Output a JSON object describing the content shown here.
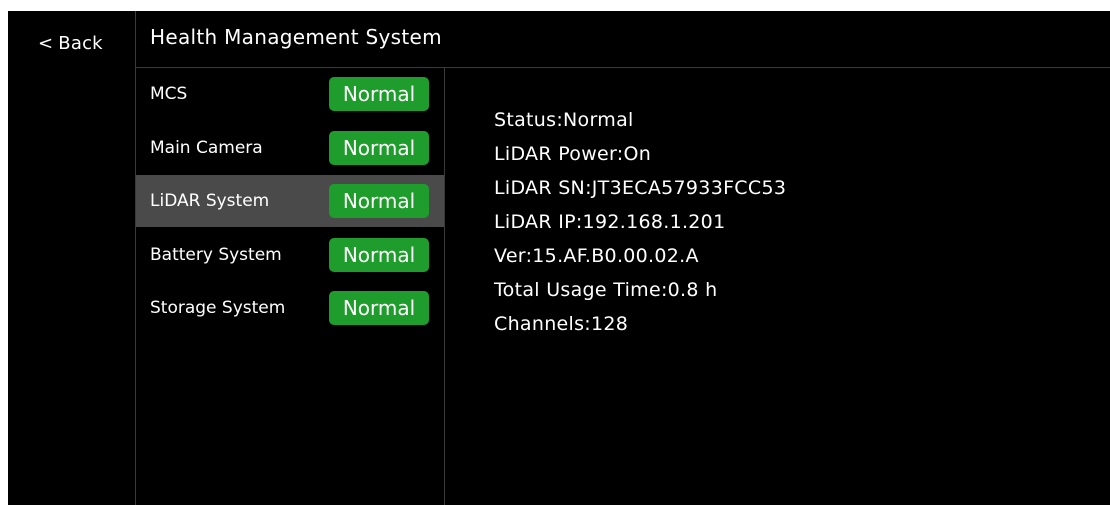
{
  "header": {
    "back_label": "Back",
    "back_icon": "chevron-left-icon",
    "title": "Health Management System"
  },
  "modules": [
    {
      "label": "MCS",
      "status": "Normal"
    },
    {
      "label": "Main Camera",
      "status": "Normal"
    },
    {
      "label": "LiDAR System",
      "status": "Normal"
    },
    {
      "label": "Battery System",
      "status": "Normal"
    },
    {
      "label": "Storage System",
      "status": "Normal"
    }
  ],
  "selected_module": "LiDAR System",
  "details": [
    "Status:Normal",
    "LiDAR Power:On",
    "LiDAR SN:JT3ECA57933FCC53",
    "LiDAR IP:192.168.1.201",
    "Ver:15.AF.B0.00.02.A",
    "Total Usage Time:0.8 h",
    "Channels:128"
  ],
  "colors": {
    "background": "#000000",
    "divider": "#3a3a3a",
    "selected_row": "#4a4a4a",
    "status_normal": "#1f9d2c",
    "text": "#ffffff"
  }
}
